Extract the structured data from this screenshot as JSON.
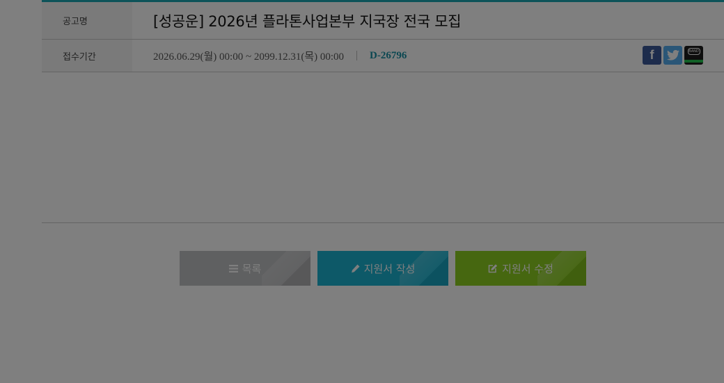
{
  "notice": {
    "title_label": "공고명",
    "title": "[성공운] 2026년 플라톤사업본부 지국장 전국 모집",
    "period_label": "접수기간",
    "period": "2026.06.29(월) 00:00 ~ 2099.12.31(목) 00:00",
    "dday": "D-26796"
  },
  "share": {
    "facebook_glyph": "f",
    "band_text": "BAND"
  },
  "buttons": {
    "list": "목록",
    "write": "지원서 작성",
    "edit": "지원서 수정"
  },
  "colors": {
    "accent": "#1aa7b3",
    "dday": "#178fa3",
    "list_button": "#bfc0c2",
    "write_button": "#1ab3d1",
    "edit_button": "#8ccf20"
  },
  "icons": {
    "list": "list-icon",
    "write": "pencil-icon",
    "edit": "edit-icon",
    "facebook": "facebook-icon",
    "twitter": "twitter-icon",
    "band": "band-icon"
  }
}
